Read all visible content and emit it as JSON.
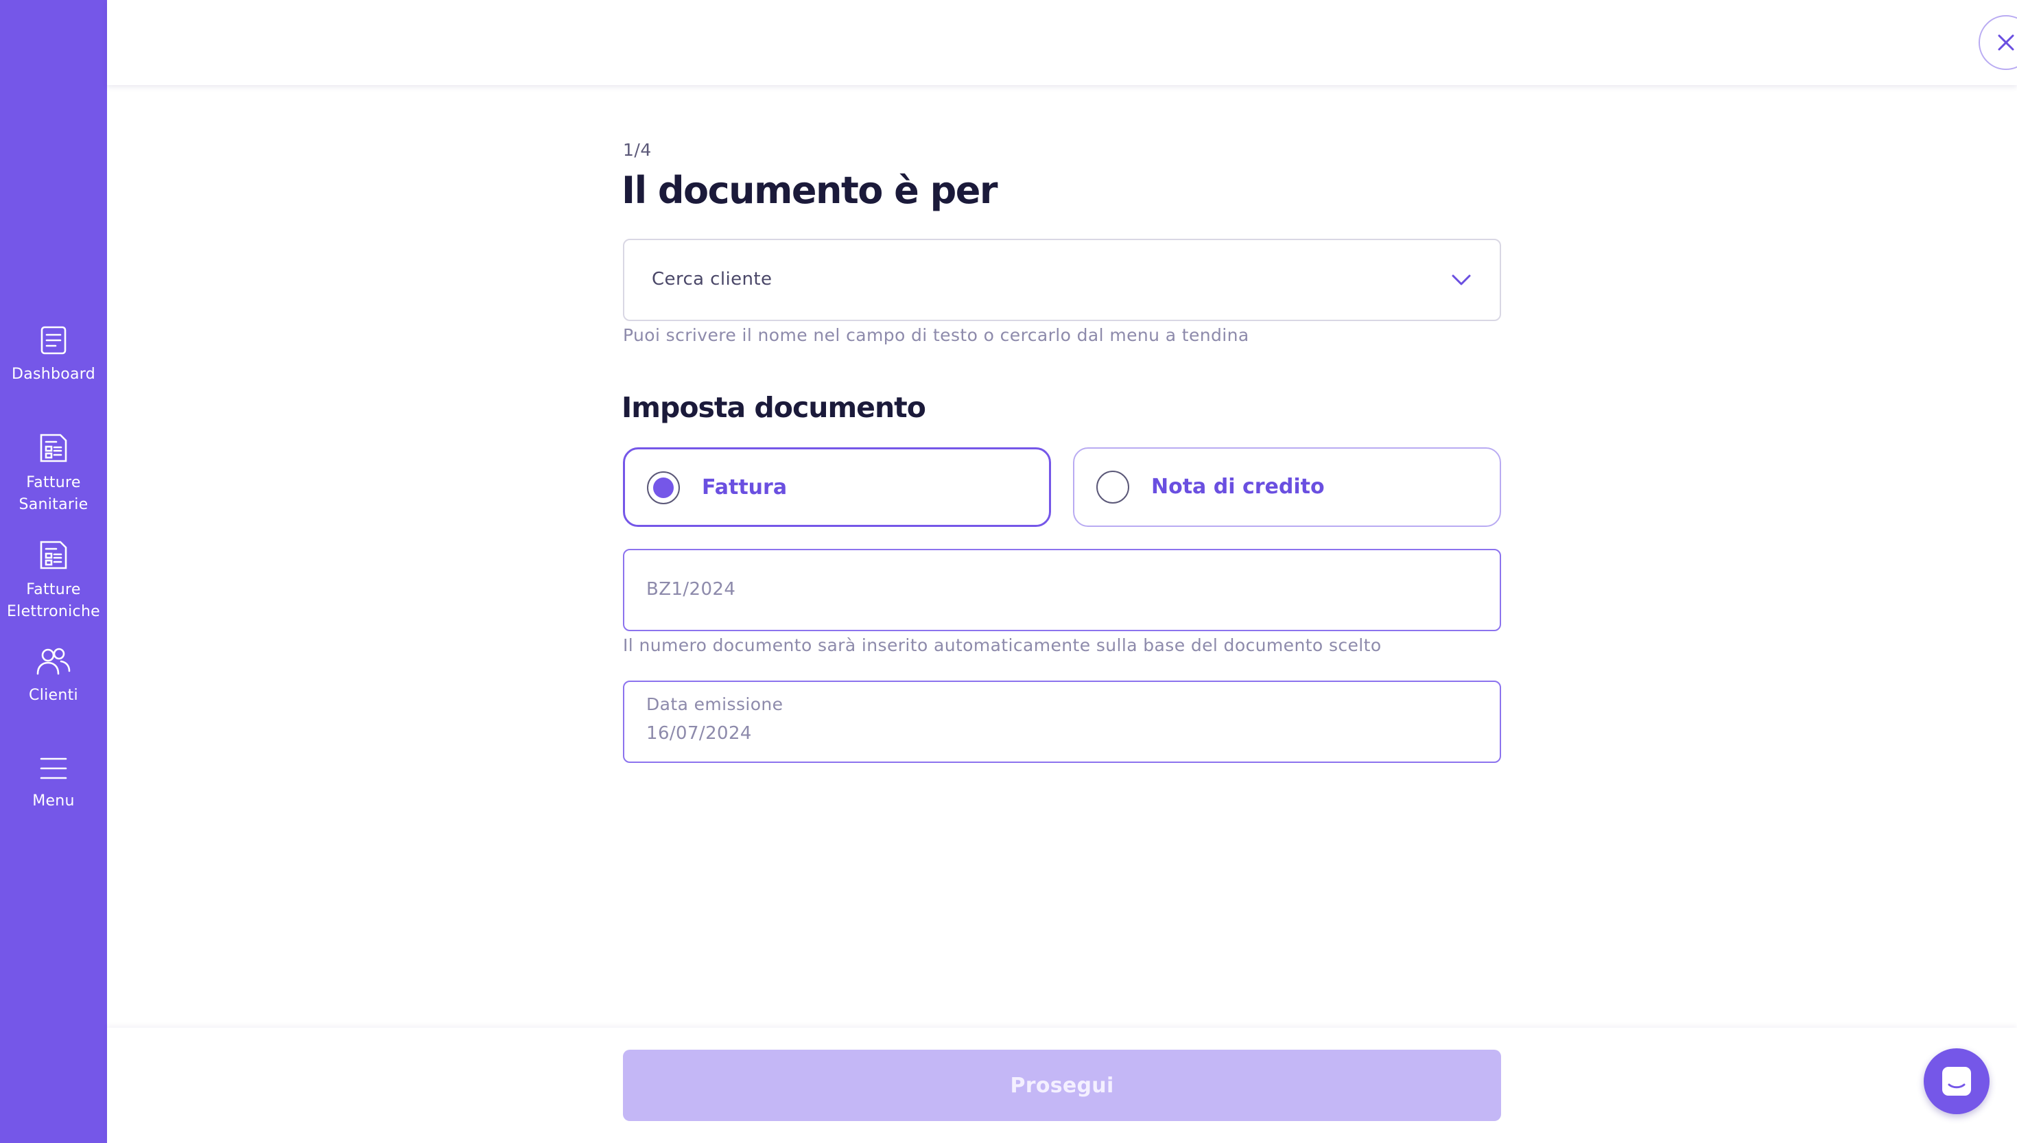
{
  "sidebar": {
    "items": [
      {
        "label": "Dashboard",
        "icon": "dashboard-icon"
      },
      {
        "label": "Fatture Sanitarie",
        "icon": "invoice-icon"
      },
      {
        "label": "Fatture Elettroniche",
        "icon": "invoice-icon"
      },
      {
        "label": "Clienti",
        "icon": "users-icon"
      },
      {
        "label": "Menu",
        "icon": "menu-icon"
      }
    ]
  },
  "form": {
    "step": "1/4",
    "title": "Il documento è per",
    "client_select": {
      "placeholder": "Cerca cliente",
      "helper": "Puoi scrivere il nome nel campo di testo o cercarlo dal menu a tendina"
    },
    "section_title": "Imposta documento",
    "document_types": [
      {
        "label": "Fattura",
        "selected": true
      },
      {
        "label": "Nota di credito",
        "selected": false
      }
    ],
    "document_number": {
      "value": "BZ1/2024",
      "helper": "Il numero documento sarà inserito automaticamente sulla base del documento scelto"
    },
    "issue_date": {
      "label": "Data emissione",
      "value": "16/07/2024"
    }
  },
  "footer": {
    "continue_label": "Prosegui"
  },
  "colors": {
    "brand": "#7557e8",
    "button_disabled": "#c4b7f6",
    "border_muted": "#d9d7e4",
    "text_dark": "#1b1a3a",
    "text_muted": "#8d8aab"
  },
  "icons": {
    "close": "close-icon",
    "dropdown": "chevron-down-icon",
    "chat": "chat-icon"
  }
}
